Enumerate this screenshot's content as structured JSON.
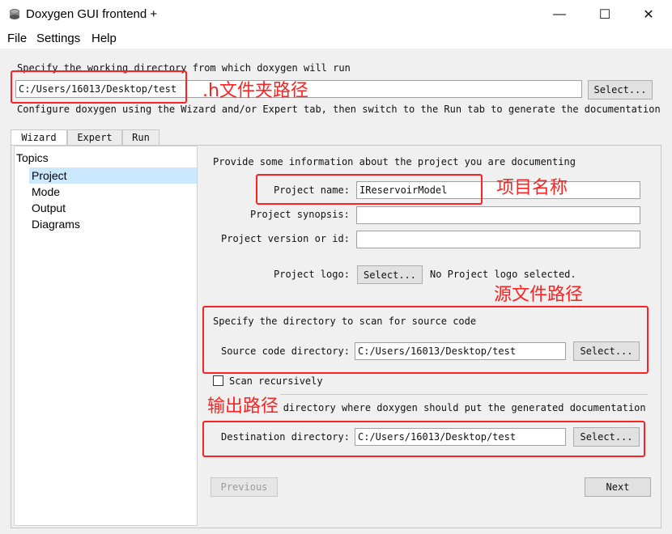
{
  "window": {
    "title": "Doxygen GUI frontend +",
    "minimize_glyph": "—",
    "maximize_glyph": "☐",
    "close_glyph": "✕",
    "app_icon": "doxygen-icon"
  },
  "menu": [
    "File",
    "Settings",
    "Help"
  ],
  "workdir": {
    "label": "Specify the working directory from which doxygen will run",
    "value": "C:/Users/16013/Desktop/test",
    "select_label": "Select...",
    "hint": "Configure doxygen using the Wizard and/or Expert tab, then switch to the Run tab to generate the documentation"
  },
  "tabs": [
    "Wizard",
    "Expert",
    "Run"
  ],
  "topics": {
    "header": "Topics",
    "items": [
      "Project",
      "Mode",
      "Output",
      "Diagrams"
    ],
    "selected": "Project"
  },
  "project": {
    "intro": "Provide some information about the project you are documenting",
    "name_label": "Project name:",
    "name_value": "IReservoirModel",
    "synopsis_label": "Project synopsis:",
    "synopsis_value": "",
    "version_label": "Project version or id:",
    "version_value": "",
    "logo_label": "Project logo:",
    "logo_button": "Select...",
    "logo_status": "No Project logo selected."
  },
  "source": {
    "intro": "Specify the directory to scan for source code",
    "dir_label": "Source code directory:",
    "dir_value": "C:/Users/16013/Desktop/test",
    "select_label": "Select...",
    "recursive_label": "Scan recursively",
    "recursive_checked": false
  },
  "dest": {
    "intro": "Specify the directory where doxygen should put the generated documentation",
    "dir_label": "Destination directory:",
    "dir_value": "C:/Users/16013/Desktop/test",
    "select_label": "Select..."
  },
  "nav": {
    "previous": "Previous",
    "next": "Next"
  },
  "annotations": {
    "header_dir": ".h文件夹路径",
    "project_name": "项目名称",
    "source_dir": "源文件路径",
    "output_dir": "输出路径",
    "color": "#ff2222"
  }
}
